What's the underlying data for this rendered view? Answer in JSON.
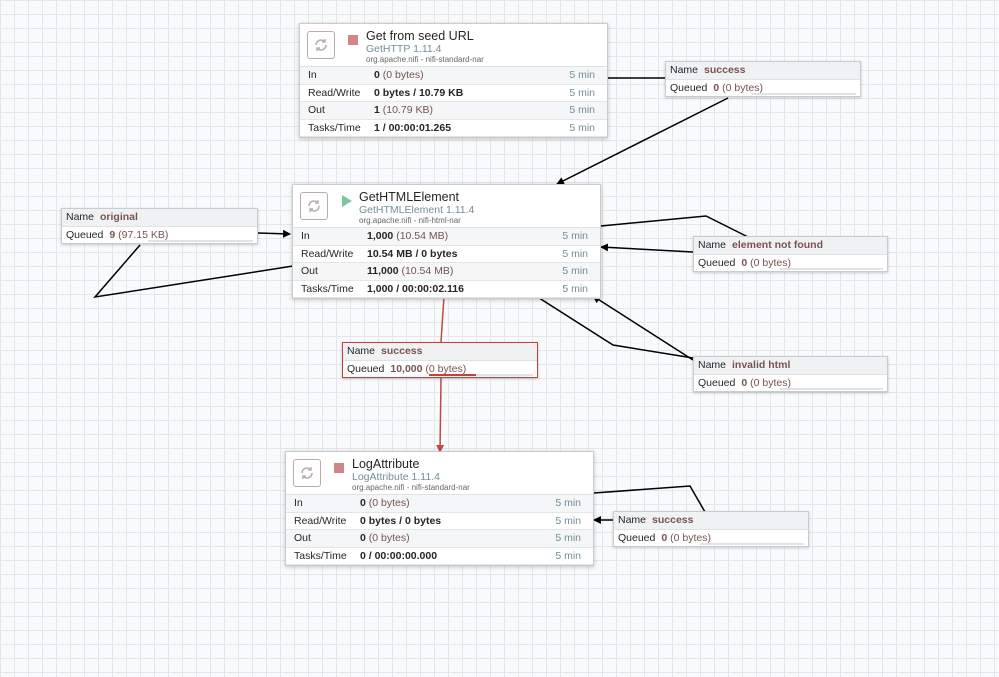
{
  "processors": [
    {
      "id": "p1",
      "name": "Get from seed URL",
      "type": "GetHTTP 1.11.4",
      "bundle": "org.apache.nifi - nifi-standard-nar",
      "state": "stopped",
      "stats": [
        {
          "label": "In",
          "value": "0",
          "paren": "(0 bytes)",
          "time": "5 min"
        },
        {
          "label": "Read/Write",
          "value": "0 bytes / 10.79 KB",
          "paren": "",
          "time": "5 min"
        },
        {
          "label": "Out",
          "value": "1",
          "paren": "(10.79 KB)",
          "time": "5 min"
        },
        {
          "label": "Tasks/Time",
          "value": "1 / 00:00:01.265",
          "paren": "",
          "time": "5 min"
        }
      ]
    },
    {
      "id": "p2",
      "name": "GetHTMLElement",
      "type": "GetHTMLElement 1.11.4",
      "bundle": "org.apache.nifi - nifi-html-nar",
      "state": "running",
      "stats": [
        {
          "label": "In",
          "value": "1,000",
          "paren": "(10.54 MB)",
          "time": "5 min"
        },
        {
          "label": "Read/Write",
          "value": "10.54 MB / 0 bytes",
          "paren": "",
          "time": "5 min"
        },
        {
          "label": "Out",
          "value": "11,000",
          "paren": "(10.54 MB)",
          "time": "5 min"
        },
        {
          "label": "Tasks/Time",
          "value": "1,000 / 00:00:02.116",
          "paren": "",
          "time": "5 min"
        }
      ]
    },
    {
      "id": "p3",
      "name": "LogAttribute",
      "type": "LogAttribute 1.11.4",
      "bundle": "org.apache.nifi - nifi-standard-nar",
      "state": "stopped",
      "stats": [
        {
          "label": "In",
          "value": "0",
          "paren": "(0 bytes)",
          "time": "5 min"
        },
        {
          "label": "Read/Write",
          "value": "0 bytes / 0 bytes",
          "paren": "",
          "time": "5 min"
        },
        {
          "label": "Out",
          "value": "0",
          "paren": "(0 bytes)",
          "time": "5 min"
        },
        {
          "label": "Tasks/Time",
          "value": "0 / 00:00:00.000",
          "paren": "",
          "time": "5 min"
        }
      ]
    }
  ],
  "connections": [
    {
      "id": "c1",
      "name_label": "Name",
      "name": "success",
      "queued_label": "Queued",
      "queued": "0",
      "paren": "(0 bytes)",
      "fill": 0
    },
    {
      "id": "c2",
      "name_label": "Name",
      "name": "original",
      "queued_label": "Queued",
      "queued": "9",
      "paren": "(97.15 KB)",
      "fill": 0
    },
    {
      "id": "c3",
      "name_label": "Name",
      "name": "element not found",
      "queued_label": "Queued",
      "queued": "0",
      "paren": "(0 bytes)",
      "fill": 0
    },
    {
      "id": "c4",
      "name_label": "Name",
      "name": "success",
      "queued_label": "Queued",
      "queued": "10,000",
      "paren": "(0 bytes)",
      "fill": 0.45
    },
    {
      "id": "c5",
      "name_label": "Name",
      "name": "invalid html",
      "queued_label": "Queued",
      "queued": "0",
      "paren": "(0 bytes)",
      "fill": 0
    },
    {
      "id": "c6",
      "name_label": "Name",
      "name": "success",
      "queued_label": "Queued",
      "queued": "0",
      "paren": "(0 bytes)",
      "fill": 0
    }
  ],
  "colors": {
    "running": "#7dc7a0",
    "stopped": "#d18686",
    "backpressure": "#c9403a",
    "link": "#000000"
  },
  "icons": {
    "processor": "processor-icon",
    "running": "play-icon",
    "stopped": "stop-icon"
  }
}
